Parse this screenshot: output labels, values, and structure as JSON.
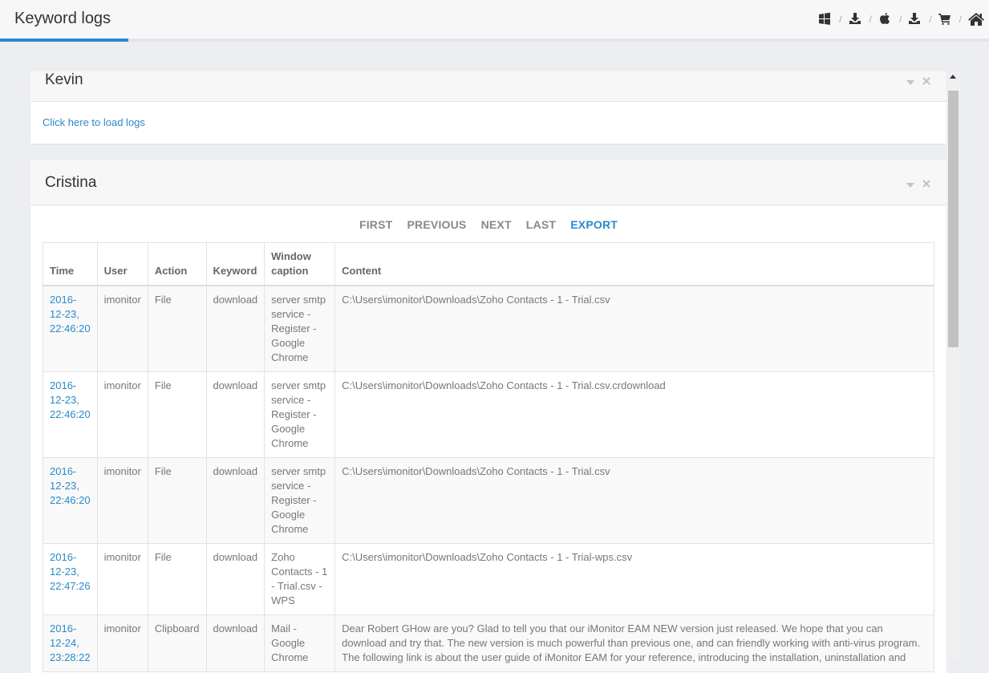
{
  "header": {
    "title": "Keyword logs",
    "icons": [
      "windows-icon",
      "download-icon",
      "apple-icon",
      "download-icon",
      "cart-icon",
      "home-icon"
    ],
    "separator": "/"
  },
  "panels": [
    {
      "name": "Kevin",
      "load_link": "Click here to load logs"
    },
    {
      "name": "Cristina",
      "pager": {
        "first": "FIRST",
        "previous": "PREVIOUS",
        "next": "NEXT",
        "last": "LAST",
        "export": "EXPORT"
      },
      "columns": [
        "Time",
        "User",
        "Action",
        "Keyword",
        "Window caption",
        "Content"
      ],
      "rows": [
        {
          "time": "2016-12-23, 22:46:20",
          "user": "imonitor",
          "action": "File",
          "keyword": "download",
          "caption": "server smtp service - Register - Google Chrome",
          "content": "C:\\Users\\imonitor\\Downloads\\Zoho Contacts - 1 - Trial.csv"
        },
        {
          "time": "2016-12-23, 22:46:20",
          "user": "imonitor",
          "action": "File",
          "keyword": "download",
          "caption": "server smtp service - Register - Google Chrome",
          "content": "C:\\Users\\imonitor\\Downloads\\Zoho Contacts - 1 - Trial.csv.crdownload"
        },
        {
          "time": "2016-12-23, 22:46:20",
          "user": "imonitor",
          "action": "File",
          "keyword": "download",
          "caption": "server smtp service - Register - Google Chrome",
          "content": "C:\\Users\\imonitor\\Downloads\\Zoho Contacts - 1 - Trial.csv"
        },
        {
          "time": "2016-12-23, 22:47:26",
          "user": "imonitor",
          "action": "File",
          "keyword": "download",
          "caption": "Zoho Contacts - 1 - Trial.csv - WPS",
          "content": "C:\\Users\\imonitor\\Downloads\\Zoho Contacts - 1 - Trial-wps.csv"
        },
        {
          "time": "2016-12-24, 23:28:22",
          "user": "imonitor",
          "action": "Clipboard",
          "keyword": "download",
          "caption": "Mail - Google Chrome",
          "content": "Dear Robert GHow are you? Glad to tell you that our iMonitor EAM NEW version just released. We hope that you can download and try that. The new version is much powerful than previous one, and can friendly working with anti-virus program. The following link is about the user guide of iMonitor EAM for your reference, introducing the installation, uninstallation and"
        }
      ]
    }
  ],
  "colors": {
    "accent": "#2a8ac8",
    "link": "#2a8ac8"
  }
}
